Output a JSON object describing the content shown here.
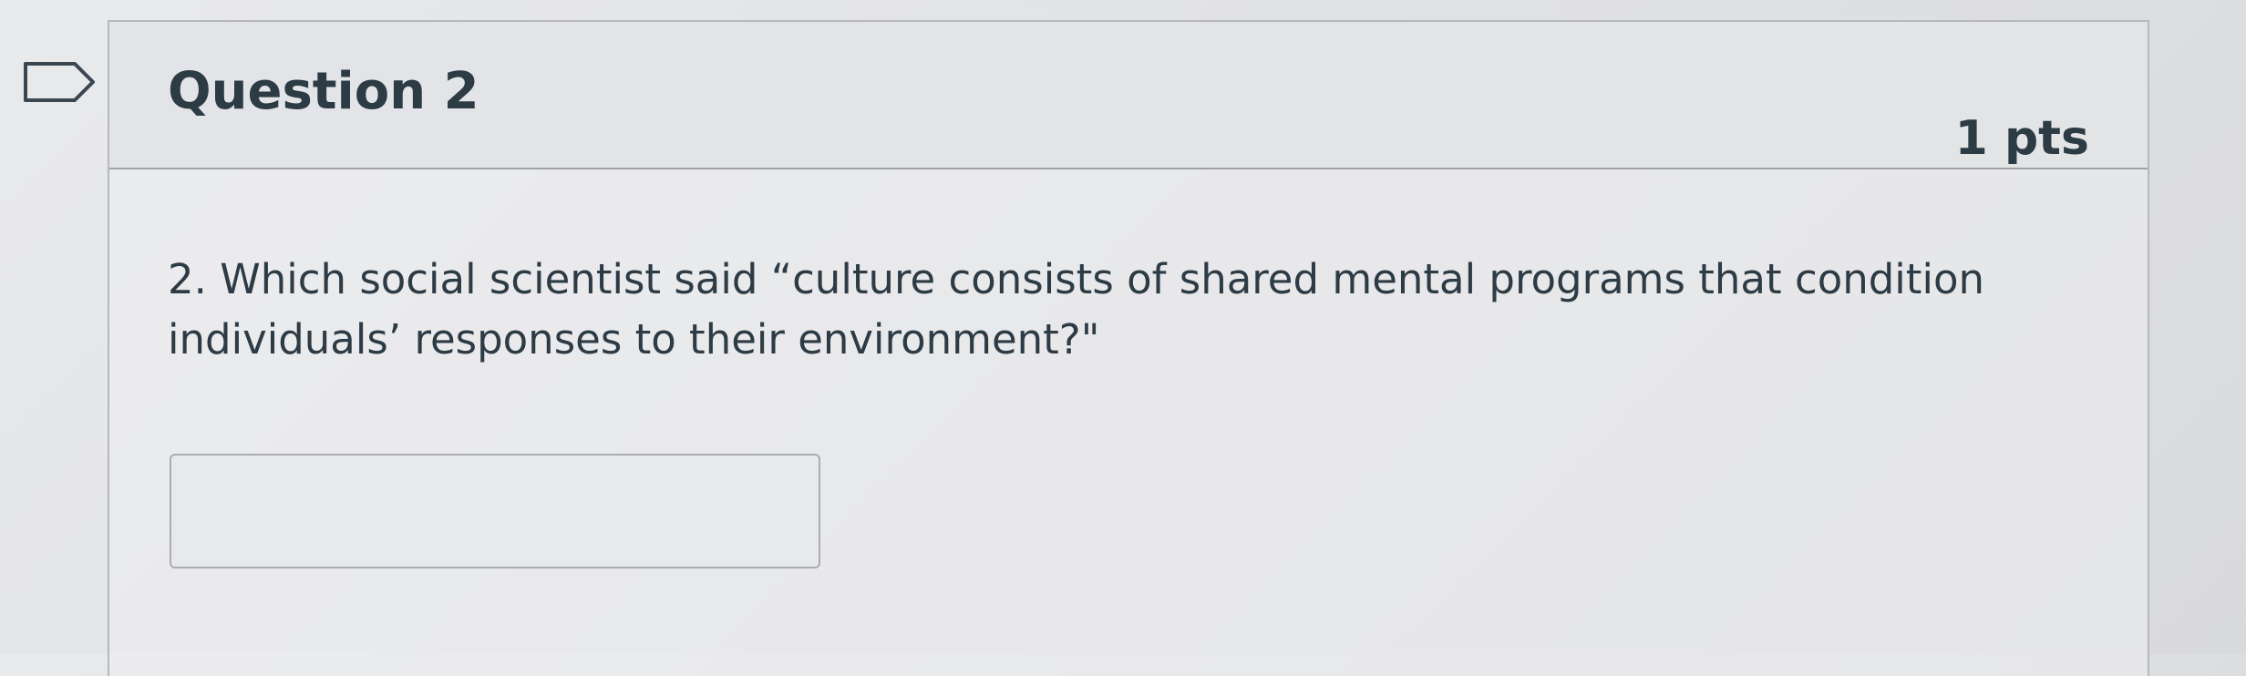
{
  "question": {
    "title": "Question 2",
    "points": "1 pts",
    "text": "2. Which social scientist said “culture consists of shared mental programs that condition individuals’ responses to their environment?\"",
    "answer_value": "",
    "answer_placeholder": ""
  },
  "icons": {
    "flag": "flag-question-icon"
  },
  "colors": {
    "text": "#2d3b45",
    "border": "#b5b8bc",
    "header_bg": "#e2e3e5",
    "page_bg": "#e1e2e4"
  }
}
